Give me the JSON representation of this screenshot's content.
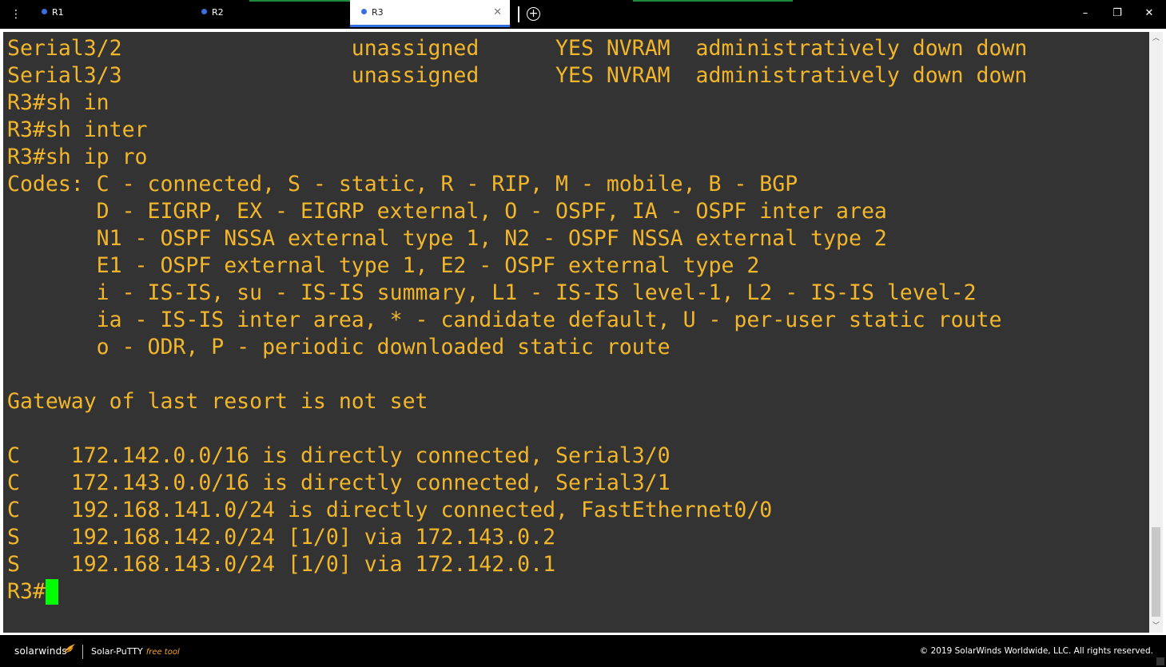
{
  "tabs": [
    {
      "label": "R1",
      "active": false
    },
    {
      "label": "R2",
      "active": false
    },
    {
      "label": "R3",
      "active": true
    }
  ],
  "window_controls": {
    "minimize": "–",
    "maximize": "❐",
    "close": "✕"
  },
  "terminal": {
    "lines": [
      "Serial3/2                  unassigned      YES NVRAM  administratively down down",
      "Serial3/3                  unassigned      YES NVRAM  administratively down down",
      "R3#sh in",
      "R3#sh inter",
      "R3#sh ip ro",
      "Codes: C - connected, S - static, R - RIP, M - mobile, B - BGP",
      "       D - EIGRP, EX - EIGRP external, O - OSPF, IA - OSPF inter area",
      "       N1 - OSPF NSSA external type 1, N2 - OSPF NSSA external type 2",
      "       E1 - OSPF external type 1, E2 - OSPF external type 2",
      "       i - IS-IS, su - IS-IS summary, L1 - IS-IS level-1, L2 - IS-IS level-2",
      "       ia - IS-IS inter area, * - candidate default, U - per-user static route",
      "       o - ODR, P - periodic downloaded static route",
      "",
      "Gateway of last resort is not set",
      "",
      "C    172.142.0.0/16 is directly connected, Serial3/0",
      "C    172.143.0.0/16 is directly connected, Serial3/1",
      "C    192.168.141.0/24 is directly connected, FastEthernet0/0",
      "S    192.168.142.0/24 [1/0] via 172.143.0.2",
      "S    192.168.143.0/24 [1/0] via 172.142.0.1"
    ],
    "prompt": "R3#",
    "text_color": "#f2b62c",
    "cursor_color": "#00ff00",
    "background": "#333333"
  },
  "footer": {
    "brand": "solarwinds",
    "product": "Solar-PuTTY",
    "free_label": "free tool",
    "copyright": "© 2019 SolarWinds Worldwide, LLC. All rights reserved."
  },
  "icons": {
    "menu": "menu-dots-icon",
    "add": "add-tab-icon",
    "close_tab": "close-tab-icon",
    "scroll_up": "scroll-up-icon",
    "scroll_down": "scroll-down-icon"
  }
}
